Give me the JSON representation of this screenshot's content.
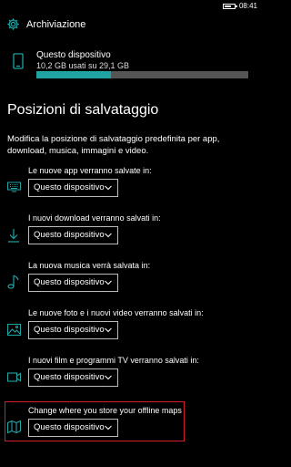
{
  "status_bar": {
    "time": "08:41",
    "battery_level": 0.75
  },
  "header": {
    "title": "Archiviazione"
  },
  "device": {
    "name": "Questo dispositivo",
    "usage": "10,2 GB usati su 29,1 GB",
    "used_fraction": 0.35
  },
  "section": {
    "title": "Posizioni di salvataggio",
    "description": "Modifica la posizione di salvataggio predefinita per app, download, musica, immagini e video."
  },
  "locations": [
    {
      "label": "Le nuove app verranno salvate in:",
      "value": "Questo dispositivo",
      "icon": "keyboard-icon"
    },
    {
      "label": "I nuovi download verranno salvati in:",
      "value": "Questo dispositivo",
      "icon": "download-icon"
    },
    {
      "label": "La nuova musica verrà salvata in:",
      "value": "Questo dispositivo",
      "icon": "music-note-icon"
    },
    {
      "label": "Le nuove foto e i nuovi video verranno salvati in:",
      "value": "Questo dispositivo",
      "icon": "image-icon"
    },
    {
      "label": "I nuovi film e programmi TV verranno salvati in:",
      "value": "Questo dispositivo",
      "icon": "video-camera-icon"
    },
    {
      "label": "Change where you store your offline maps",
      "value": "Questo dispositivo",
      "icon": "map-icon"
    }
  ],
  "colors": {
    "accent": "#1fa3a3",
    "highlight": "#d21f2a",
    "background": "#000000"
  }
}
